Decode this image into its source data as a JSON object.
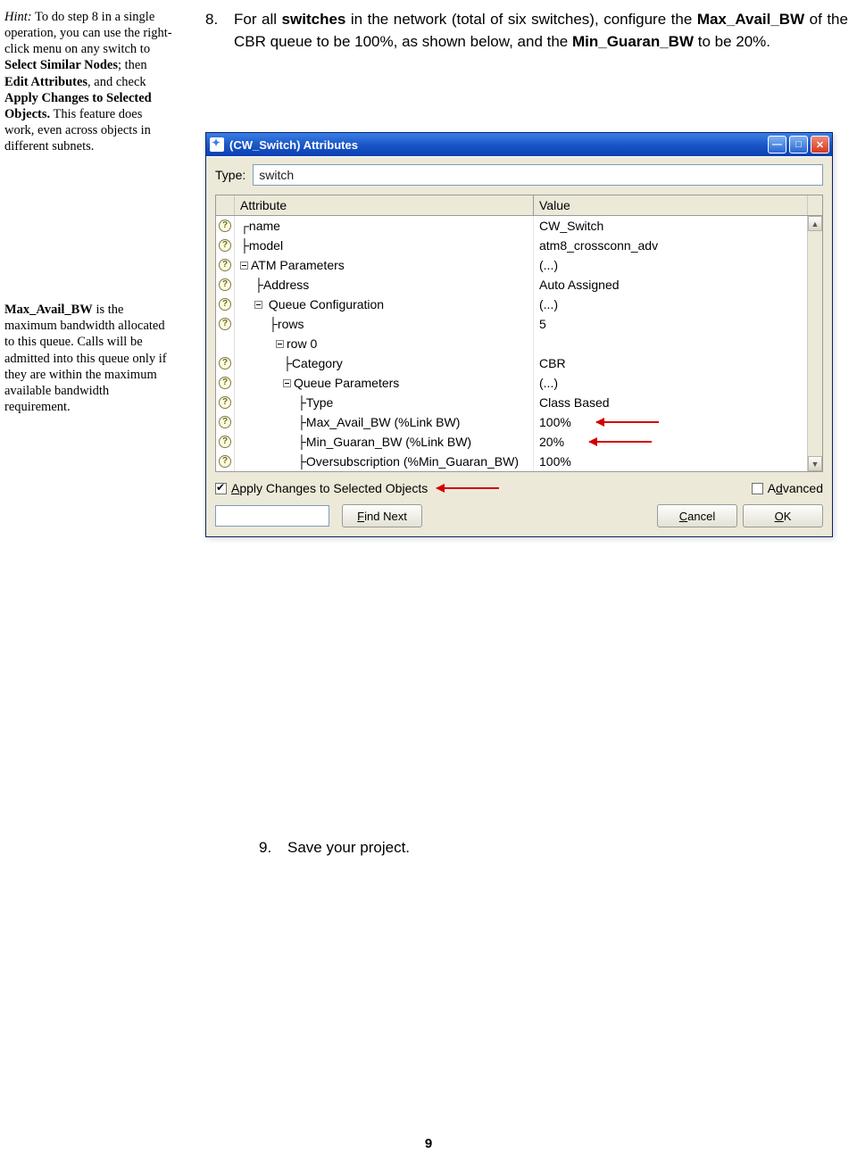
{
  "sidebar": {
    "hint_label": "Hint:",
    "hint_text_1": " To do step 8 in a single operation, you can use the right-click menu on any switch to ",
    "hint_bold_1": "Select Similar Nodes",
    "hint_text_2": "; then ",
    "hint_bold_2": "Edit Attributes",
    "hint_text_3": ", and check ",
    "hint_bold_3": "Apply Changes to Selected Objects.",
    "hint_text_4": " This feature does work, even across objects in different subnets.",
    "note2_b1": "Max_Avail_BW",
    "note2_t1": " is the maximum bandwidth allocated to this queue. Calls will be admitted into this queue only if they are within the maximum available bandwidth requirement."
  },
  "main": {
    "step8_num": "8.",
    "step8_a": "For all ",
    "step8_b1": "switches",
    "step8_b": " in the network (total of six switches), configure the ",
    "step8_b2": "Max_Avail_BW",
    "step8_c": " of the CBR queue to be 100%, as shown below, and the ",
    "step8_b3": "Min_Guaran_BW",
    "step8_d": " to be 20%.",
    "step9_num": "9.",
    "step9_txt": "Save your project."
  },
  "dialog": {
    "title": "(CW_Switch) Attributes",
    "type_label": "Type:",
    "type_value": "switch",
    "head_attr": "Attribute",
    "head_val": "Value",
    "rows": [
      {
        "icon": "q",
        "attr": "┌name",
        "val": "CW_Switch"
      },
      {
        "icon": "q",
        "attr": "├model",
        "val": "atm8_crossconn_adv"
      },
      {
        "icon": "q",
        "attr": "⊟ATM Parameters",
        "val": "(...)",
        "box": "minus",
        "indent": 0
      },
      {
        "icon": "q",
        "attr": "├Address",
        "val": "Auto Assigned",
        "indent": 1
      },
      {
        "icon": "q",
        "attr": "⊟ Queue Configuration",
        "val": "(...)",
        "box": "minus",
        "indent": 1
      },
      {
        "icon": "q",
        "attr": "├rows",
        "val": "5",
        "indent": 2
      },
      {
        "icon": "",
        "attr": "⊟row 0",
        "val": "",
        "box": "minus",
        "indent": 2.5
      },
      {
        "icon": "q",
        "attr": "├Category",
        "val": "CBR",
        "indent": 3
      },
      {
        "icon": "q",
        "attr": "⊟Queue Parameters",
        "val": "(...)",
        "box": "minus",
        "indent": 3
      },
      {
        "icon": "q",
        "attr": "├Type",
        "val": "Class Based",
        "indent": 4
      },
      {
        "icon": "q",
        "attr": "├Max_Avail_BW (%Link BW)",
        "val": "100%",
        "indent": 4,
        "arrow": true
      },
      {
        "icon": "q",
        "attr": "├Min_Guaran_BW (%Link BW)",
        "val": "20%",
        "indent": 4,
        "arrow": true
      },
      {
        "icon": "q",
        "attr": "├Oversubscription (%Min_Guaran_BW)",
        "val": "100%",
        "indent": 4
      }
    ],
    "apply_label_a": "A",
    "apply_label_b": "pply Changes to Selected Objects",
    "advanced_a": "A",
    "advanced_d": "d",
    "advanced_b": "vanced",
    "findnext_f": "F",
    "findnext_rest": "ind Next",
    "cancel_c": "C",
    "cancel_rest": "ancel",
    "ok_o": "O",
    "ok_rest": "K"
  },
  "page_number": "9"
}
